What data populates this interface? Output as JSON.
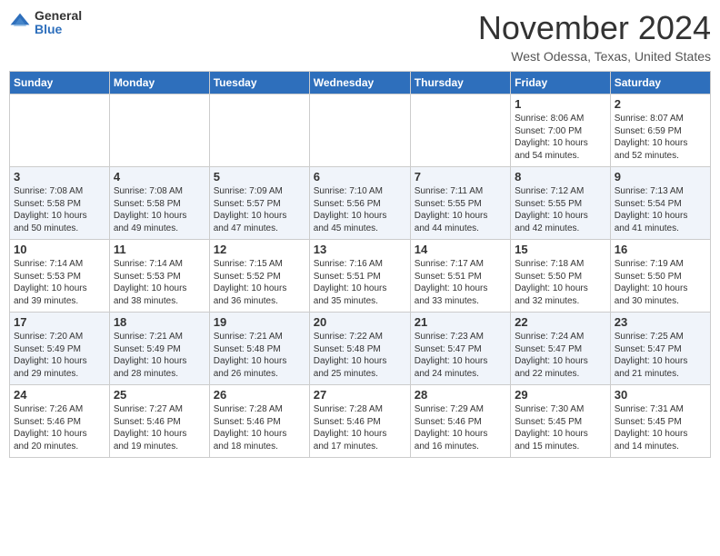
{
  "logo": {
    "general": "General",
    "blue": "Blue"
  },
  "header": {
    "month": "November 2024",
    "location": "West Odessa, Texas, United States"
  },
  "weekdays": [
    "Sunday",
    "Monday",
    "Tuesday",
    "Wednesday",
    "Thursday",
    "Friday",
    "Saturday"
  ],
  "weeks": [
    [
      {
        "day": "",
        "info": ""
      },
      {
        "day": "",
        "info": ""
      },
      {
        "day": "",
        "info": ""
      },
      {
        "day": "",
        "info": ""
      },
      {
        "day": "",
        "info": ""
      },
      {
        "day": "1",
        "info": "Sunrise: 8:06 AM\nSunset: 7:00 PM\nDaylight: 10 hours\nand 54 minutes."
      },
      {
        "day": "2",
        "info": "Sunrise: 8:07 AM\nSunset: 6:59 PM\nDaylight: 10 hours\nand 52 minutes."
      }
    ],
    [
      {
        "day": "3",
        "info": "Sunrise: 7:08 AM\nSunset: 5:58 PM\nDaylight: 10 hours\nand 50 minutes."
      },
      {
        "day": "4",
        "info": "Sunrise: 7:08 AM\nSunset: 5:58 PM\nDaylight: 10 hours\nand 49 minutes."
      },
      {
        "day": "5",
        "info": "Sunrise: 7:09 AM\nSunset: 5:57 PM\nDaylight: 10 hours\nand 47 minutes."
      },
      {
        "day": "6",
        "info": "Sunrise: 7:10 AM\nSunset: 5:56 PM\nDaylight: 10 hours\nand 45 minutes."
      },
      {
        "day": "7",
        "info": "Sunrise: 7:11 AM\nSunset: 5:55 PM\nDaylight: 10 hours\nand 44 minutes."
      },
      {
        "day": "8",
        "info": "Sunrise: 7:12 AM\nSunset: 5:55 PM\nDaylight: 10 hours\nand 42 minutes."
      },
      {
        "day": "9",
        "info": "Sunrise: 7:13 AM\nSunset: 5:54 PM\nDaylight: 10 hours\nand 41 minutes."
      }
    ],
    [
      {
        "day": "10",
        "info": "Sunrise: 7:14 AM\nSunset: 5:53 PM\nDaylight: 10 hours\nand 39 minutes."
      },
      {
        "day": "11",
        "info": "Sunrise: 7:14 AM\nSunset: 5:53 PM\nDaylight: 10 hours\nand 38 minutes."
      },
      {
        "day": "12",
        "info": "Sunrise: 7:15 AM\nSunset: 5:52 PM\nDaylight: 10 hours\nand 36 minutes."
      },
      {
        "day": "13",
        "info": "Sunrise: 7:16 AM\nSunset: 5:51 PM\nDaylight: 10 hours\nand 35 minutes."
      },
      {
        "day": "14",
        "info": "Sunrise: 7:17 AM\nSunset: 5:51 PM\nDaylight: 10 hours\nand 33 minutes."
      },
      {
        "day": "15",
        "info": "Sunrise: 7:18 AM\nSunset: 5:50 PM\nDaylight: 10 hours\nand 32 minutes."
      },
      {
        "day": "16",
        "info": "Sunrise: 7:19 AM\nSunset: 5:50 PM\nDaylight: 10 hours\nand 30 minutes."
      }
    ],
    [
      {
        "day": "17",
        "info": "Sunrise: 7:20 AM\nSunset: 5:49 PM\nDaylight: 10 hours\nand 29 minutes."
      },
      {
        "day": "18",
        "info": "Sunrise: 7:21 AM\nSunset: 5:49 PM\nDaylight: 10 hours\nand 28 minutes."
      },
      {
        "day": "19",
        "info": "Sunrise: 7:21 AM\nSunset: 5:48 PM\nDaylight: 10 hours\nand 26 minutes."
      },
      {
        "day": "20",
        "info": "Sunrise: 7:22 AM\nSunset: 5:48 PM\nDaylight: 10 hours\nand 25 minutes."
      },
      {
        "day": "21",
        "info": "Sunrise: 7:23 AM\nSunset: 5:47 PM\nDaylight: 10 hours\nand 24 minutes."
      },
      {
        "day": "22",
        "info": "Sunrise: 7:24 AM\nSunset: 5:47 PM\nDaylight: 10 hours\nand 22 minutes."
      },
      {
        "day": "23",
        "info": "Sunrise: 7:25 AM\nSunset: 5:47 PM\nDaylight: 10 hours\nand 21 minutes."
      }
    ],
    [
      {
        "day": "24",
        "info": "Sunrise: 7:26 AM\nSunset: 5:46 PM\nDaylight: 10 hours\nand 20 minutes."
      },
      {
        "day": "25",
        "info": "Sunrise: 7:27 AM\nSunset: 5:46 PM\nDaylight: 10 hours\nand 19 minutes."
      },
      {
        "day": "26",
        "info": "Sunrise: 7:28 AM\nSunset: 5:46 PM\nDaylight: 10 hours\nand 18 minutes."
      },
      {
        "day": "27",
        "info": "Sunrise: 7:28 AM\nSunset: 5:46 PM\nDaylight: 10 hours\nand 17 minutes."
      },
      {
        "day": "28",
        "info": "Sunrise: 7:29 AM\nSunset: 5:46 PM\nDaylight: 10 hours\nand 16 minutes."
      },
      {
        "day": "29",
        "info": "Sunrise: 7:30 AM\nSunset: 5:45 PM\nDaylight: 10 hours\nand 15 minutes."
      },
      {
        "day": "30",
        "info": "Sunrise: 7:31 AM\nSunset: 5:45 PM\nDaylight: 10 hours\nand 14 minutes."
      }
    ]
  ]
}
